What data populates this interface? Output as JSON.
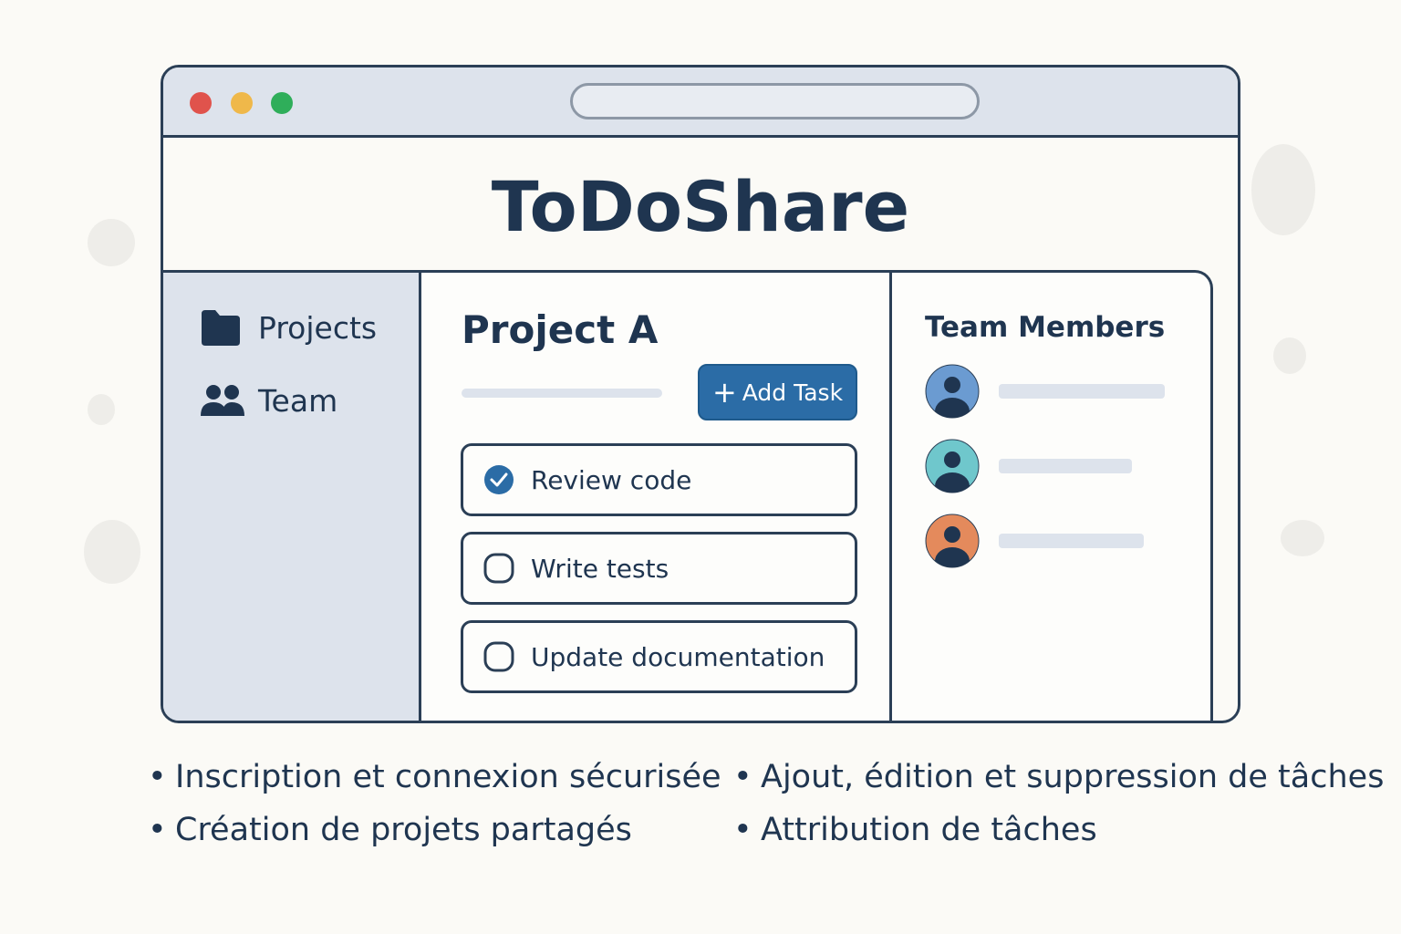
{
  "window": {
    "controls": [
      "close",
      "minimize",
      "maximize"
    ],
    "colors": {
      "close": "#e0534c",
      "minimize": "#efb84a",
      "maximize": "#2fae5a"
    }
  },
  "app": {
    "title": "ToDoShare"
  },
  "sidebar": {
    "items": [
      {
        "label": "Projects",
        "icon": "folder-icon"
      },
      {
        "label": "Team",
        "icon": "users-icon"
      }
    ]
  },
  "main": {
    "project_title": "Project A",
    "add_task_label": "Add Task",
    "accent": "#2b6ca6",
    "tasks": [
      {
        "label": "Review code",
        "done": true
      },
      {
        "label": "Write tests",
        "done": false
      },
      {
        "label": "Update documentation",
        "done": false
      }
    ]
  },
  "team": {
    "title": "Team Members",
    "members": [
      {
        "avatar_color": "#6b9bd1"
      },
      {
        "avatar_color": "#6fc7cc"
      },
      {
        "avatar_color": "#e48a5c"
      }
    ]
  },
  "features": [
    "Inscription et connexion sécurisée",
    "Ajout, édition et suppression de tâches",
    "Création de projets partagés",
    "Attribution de tâches"
  ]
}
